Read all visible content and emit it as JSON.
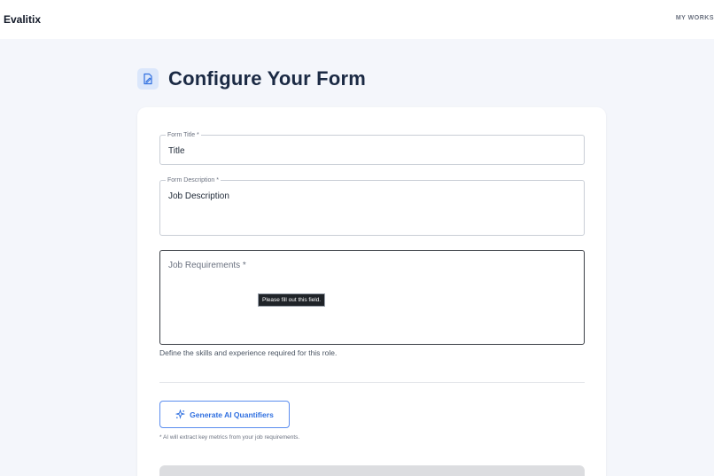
{
  "header": {
    "brand": "Evalitix",
    "nav_link": "MY WORKS"
  },
  "page": {
    "title": "Configure Your Form",
    "title_icon": "form-edit-icon"
  },
  "form": {
    "title_field": {
      "label": "Form Title *",
      "value": "Title"
    },
    "description_field": {
      "label": "Form Description *",
      "value": "Job Description"
    },
    "requirements_field": {
      "placeholder": "Job Requirements *",
      "value": "",
      "validation_tooltip": "Please fill out this field.",
      "helper": "Define the skills and experience required for this role."
    },
    "ai_button": {
      "label": "Generate AI Quantifiers",
      "icon": "sparkle-icon"
    },
    "ai_note": "* AI will extract key metrics from your job requirements."
  },
  "colors": {
    "accent": "#2f6fe0",
    "background": "#f4f6fb",
    "title": "#1b2a44"
  }
}
